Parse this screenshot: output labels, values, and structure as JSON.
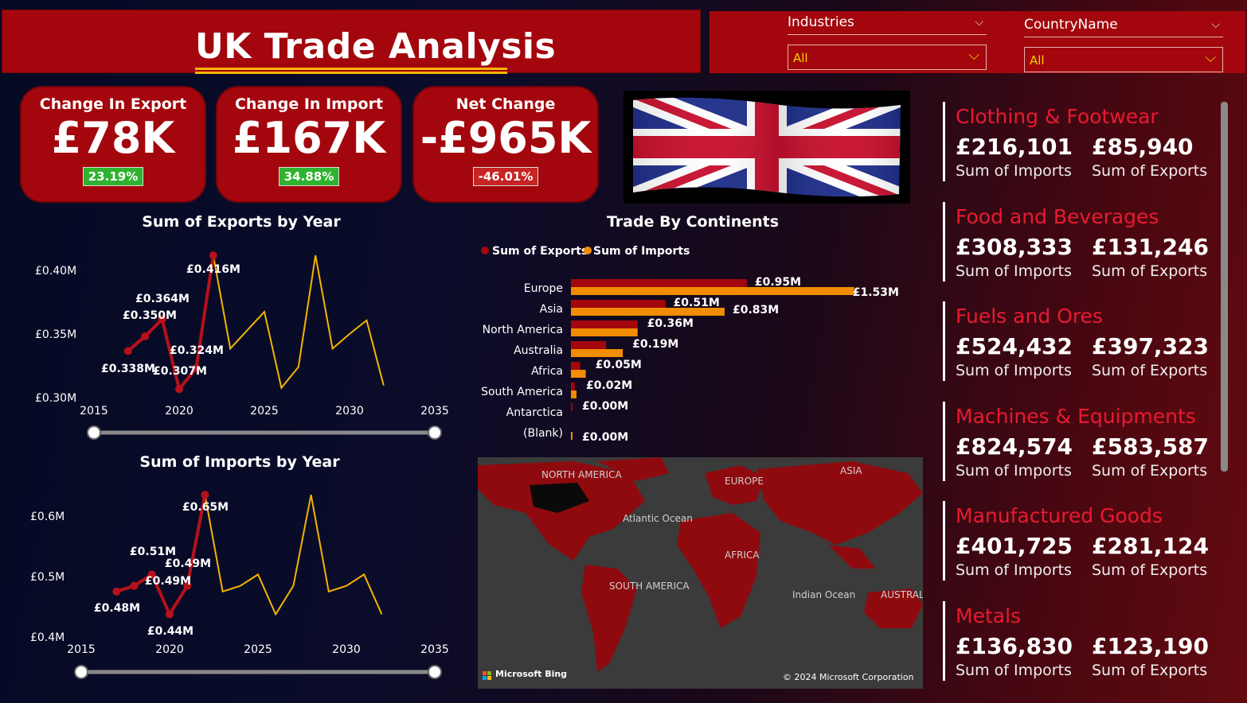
{
  "header": {
    "title": "UK Trade Analysis"
  },
  "filters": {
    "industries": {
      "label": "Industries",
      "value": "All"
    },
    "country": {
      "label": "CountryName",
      "value": "All"
    }
  },
  "kpis": [
    {
      "title": "Change In Export",
      "value": "£78K",
      "badge": "23.19%",
      "trend": "positive"
    },
    {
      "title": "Change In Import",
      "value": "£167K",
      "badge": "34.88%",
      "trend": "positive"
    },
    {
      "title": "Net Change",
      "value": "-£965K",
      "badge": "-46.01%",
      "trend": "negative"
    }
  ],
  "exports_chart": {
    "title": "Sum of Exports by Year",
    "y_ticks": [
      "£0.40M",
      "£0.35M",
      "£0.30M"
    ],
    "x_ticks": [
      "2015",
      "2020",
      "2025",
      "2030",
      "2035"
    ],
    "labels": [
      "£0.338M",
      "£0.350M",
      "£0.364M",
      "£0.307M",
      "£0.324M",
      "£0.416M"
    ]
  },
  "imports_chart": {
    "title": "Sum of Imports by Year",
    "y_ticks": [
      "£0.6M",
      "£0.5M",
      "£0.4M"
    ],
    "x_ticks": [
      "2015",
      "2020",
      "2025",
      "2030",
      "2035"
    ],
    "labels": [
      "£0.48M",
      "£0.51M",
      "£0.49M",
      "£0.44M",
      "£0.49M",
      "£0.65M"
    ]
  },
  "chart_data": [
    {
      "type": "line",
      "title": "Sum of Exports by Year",
      "xlim": [
        2015,
        2035
      ],
      "ylim": [
        0.3,
        0.42
      ],
      "series": [
        {
          "name": "actual",
          "x": [
            2017,
            2018,
            2019,
            2020,
            2021,
            2022
          ],
          "values": [
            0.338,
            0.35,
            0.364,
            0.307,
            0.324,
            0.416
          ]
        },
        {
          "name": "forecast",
          "x": [
            2022,
            2023,
            2024,
            2025,
            2026,
            2027,
            2028,
            2029,
            2030,
            2031,
            2032
          ],
          "values": [
            0.416,
            0.34,
            0.355,
            0.37,
            0.308,
            0.325,
            0.416,
            0.34,
            0.352,
            0.363,
            0.31
          ]
        }
      ]
    },
    {
      "type": "line",
      "title": "Sum of Imports by Year",
      "xlim": [
        2015,
        2035
      ],
      "ylim": [
        0.4,
        0.67
      ],
      "series": [
        {
          "name": "actual",
          "x": [
            2017,
            2018,
            2019,
            2020,
            2021,
            2022
          ],
          "values": [
            0.48,
            0.49,
            0.51,
            0.44,
            0.49,
            0.65
          ]
        },
        {
          "name": "forecast",
          "x": [
            2022,
            2023,
            2024,
            2025,
            2026,
            2027,
            2028,
            2029,
            2030,
            2031,
            2032
          ],
          "values": [
            0.65,
            0.48,
            0.49,
            0.51,
            0.44,
            0.49,
            0.65,
            0.48,
            0.49,
            0.51,
            0.44
          ]
        }
      ]
    },
    {
      "type": "bar",
      "title": "Trade By Continents",
      "orientation": "horizontal",
      "categories": [
        "Europe",
        "Asia",
        "North America",
        "Australia",
        "Africa",
        "South America",
        "Antarctica",
        "(Blank)"
      ],
      "legend": "top-left",
      "series": [
        {
          "name": "Sum of Exports",
          "values": [
            0.95,
            0.51,
            0.36,
            0.19,
            0.05,
            0.02,
            0.0,
            0.0
          ]
        },
        {
          "name": "Sum of Imports",
          "values": [
            1.53,
            0.83,
            0.36,
            0.28,
            0.08,
            0.03,
            0.0,
            0.0
          ]
        }
      ],
      "value_labels": [
        "£0.95M",
        "£1.53M",
        "£0.51M",
        "£0.83M",
        "£0.36M",
        "£0.19M",
        "£0.05M",
        "£0.02M",
        "£0.00M",
        "£0.00M"
      ],
      "xlim": [
        0,
        1.6
      ]
    }
  ],
  "continents_chart": {
    "title": "Trade By Continents",
    "legend": [
      "Sum of Exports",
      "Sum of Imports"
    ],
    "colors": {
      "exports": "#a3070d",
      "imports": "#f28c00"
    }
  },
  "map": {
    "labels": [
      "NORTH AMERICA",
      "EUROPE",
      "ASIA",
      "Atlantic Ocean",
      "AFRICA",
      "SOUTH AMERICA",
      "Indian Ocean",
      "AUSTRAL"
    ],
    "brand": "Microsoft Bing",
    "copyright": "© 2024 Microsoft Corporation"
  },
  "industries": [
    {
      "name": "Clothing & Footwear",
      "imports": "£216,101",
      "exports": "£85,940"
    },
    {
      "name": "Food and Beverages",
      "imports": "£308,333",
      "exports": "£131,246"
    },
    {
      "name": "Fuels and Ores",
      "imports": "£524,432",
      "exports": "£397,323"
    },
    {
      "name": "Machines & Equipments",
      "imports": "£824,574",
      "exports": "£583,587"
    },
    {
      "name": "Manufactured Goods",
      "imports": "£401,725",
      "exports": "£281,124"
    },
    {
      "name": "Metals",
      "imports": "£136,830",
      "exports": "£123,190"
    }
  ],
  "card_labels": {
    "imports": "Sum of Imports",
    "exports": "Sum of Exports"
  },
  "colors": {
    "brand_red": "#a3070d",
    "accent_orange": "#f28c00",
    "line_yellow": "#f4b400",
    "title_red": "#ea1a30"
  }
}
